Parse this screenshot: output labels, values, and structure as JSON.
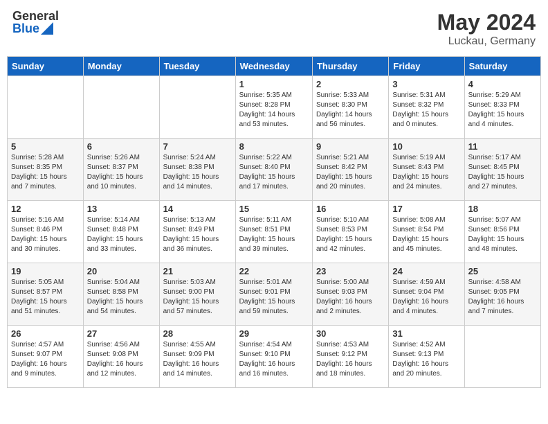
{
  "header": {
    "logo_general": "General",
    "logo_blue": "Blue",
    "month": "May 2024",
    "location": "Luckau, Germany"
  },
  "weekdays": [
    "Sunday",
    "Monday",
    "Tuesday",
    "Wednesday",
    "Thursday",
    "Friday",
    "Saturday"
  ],
  "weeks": [
    [
      {
        "day": "",
        "info": ""
      },
      {
        "day": "",
        "info": ""
      },
      {
        "day": "",
        "info": ""
      },
      {
        "day": "1",
        "info": "Sunrise: 5:35 AM\nSunset: 8:28 PM\nDaylight: 14 hours\nand 53 minutes."
      },
      {
        "day": "2",
        "info": "Sunrise: 5:33 AM\nSunset: 8:30 PM\nDaylight: 14 hours\nand 56 minutes."
      },
      {
        "day": "3",
        "info": "Sunrise: 5:31 AM\nSunset: 8:32 PM\nDaylight: 15 hours\nand 0 minutes."
      },
      {
        "day": "4",
        "info": "Sunrise: 5:29 AM\nSunset: 8:33 PM\nDaylight: 15 hours\nand 4 minutes."
      }
    ],
    [
      {
        "day": "5",
        "info": "Sunrise: 5:28 AM\nSunset: 8:35 PM\nDaylight: 15 hours\nand 7 minutes."
      },
      {
        "day": "6",
        "info": "Sunrise: 5:26 AM\nSunset: 8:37 PM\nDaylight: 15 hours\nand 10 minutes."
      },
      {
        "day": "7",
        "info": "Sunrise: 5:24 AM\nSunset: 8:38 PM\nDaylight: 15 hours\nand 14 minutes."
      },
      {
        "day": "8",
        "info": "Sunrise: 5:22 AM\nSunset: 8:40 PM\nDaylight: 15 hours\nand 17 minutes."
      },
      {
        "day": "9",
        "info": "Sunrise: 5:21 AM\nSunset: 8:42 PM\nDaylight: 15 hours\nand 20 minutes."
      },
      {
        "day": "10",
        "info": "Sunrise: 5:19 AM\nSunset: 8:43 PM\nDaylight: 15 hours\nand 24 minutes."
      },
      {
        "day": "11",
        "info": "Sunrise: 5:17 AM\nSunset: 8:45 PM\nDaylight: 15 hours\nand 27 minutes."
      }
    ],
    [
      {
        "day": "12",
        "info": "Sunrise: 5:16 AM\nSunset: 8:46 PM\nDaylight: 15 hours\nand 30 minutes."
      },
      {
        "day": "13",
        "info": "Sunrise: 5:14 AM\nSunset: 8:48 PM\nDaylight: 15 hours\nand 33 minutes."
      },
      {
        "day": "14",
        "info": "Sunrise: 5:13 AM\nSunset: 8:49 PM\nDaylight: 15 hours\nand 36 minutes."
      },
      {
        "day": "15",
        "info": "Sunrise: 5:11 AM\nSunset: 8:51 PM\nDaylight: 15 hours\nand 39 minutes."
      },
      {
        "day": "16",
        "info": "Sunrise: 5:10 AM\nSunset: 8:53 PM\nDaylight: 15 hours\nand 42 minutes."
      },
      {
        "day": "17",
        "info": "Sunrise: 5:08 AM\nSunset: 8:54 PM\nDaylight: 15 hours\nand 45 minutes."
      },
      {
        "day": "18",
        "info": "Sunrise: 5:07 AM\nSunset: 8:56 PM\nDaylight: 15 hours\nand 48 minutes."
      }
    ],
    [
      {
        "day": "19",
        "info": "Sunrise: 5:05 AM\nSunset: 8:57 PM\nDaylight: 15 hours\nand 51 minutes."
      },
      {
        "day": "20",
        "info": "Sunrise: 5:04 AM\nSunset: 8:58 PM\nDaylight: 15 hours\nand 54 minutes."
      },
      {
        "day": "21",
        "info": "Sunrise: 5:03 AM\nSunset: 9:00 PM\nDaylight: 15 hours\nand 57 minutes."
      },
      {
        "day": "22",
        "info": "Sunrise: 5:01 AM\nSunset: 9:01 PM\nDaylight: 15 hours\nand 59 minutes."
      },
      {
        "day": "23",
        "info": "Sunrise: 5:00 AM\nSunset: 9:03 PM\nDaylight: 16 hours\nand 2 minutes."
      },
      {
        "day": "24",
        "info": "Sunrise: 4:59 AM\nSunset: 9:04 PM\nDaylight: 16 hours\nand 4 minutes."
      },
      {
        "day": "25",
        "info": "Sunrise: 4:58 AM\nSunset: 9:05 PM\nDaylight: 16 hours\nand 7 minutes."
      }
    ],
    [
      {
        "day": "26",
        "info": "Sunrise: 4:57 AM\nSunset: 9:07 PM\nDaylight: 16 hours\nand 9 minutes."
      },
      {
        "day": "27",
        "info": "Sunrise: 4:56 AM\nSunset: 9:08 PM\nDaylight: 16 hours\nand 12 minutes."
      },
      {
        "day": "28",
        "info": "Sunrise: 4:55 AM\nSunset: 9:09 PM\nDaylight: 16 hours\nand 14 minutes."
      },
      {
        "day": "29",
        "info": "Sunrise: 4:54 AM\nSunset: 9:10 PM\nDaylight: 16 hours\nand 16 minutes."
      },
      {
        "day": "30",
        "info": "Sunrise: 4:53 AM\nSunset: 9:12 PM\nDaylight: 16 hours\nand 18 minutes."
      },
      {
        "day": "31",
        "info": "Sunrise: 4:52 AM\nSunset: 9:13 PM\nDaylight: 16 hours\nand 20 minutes."
      },
      {
        "day": "",
        "info": ""
      }
    ]
  ]
}
